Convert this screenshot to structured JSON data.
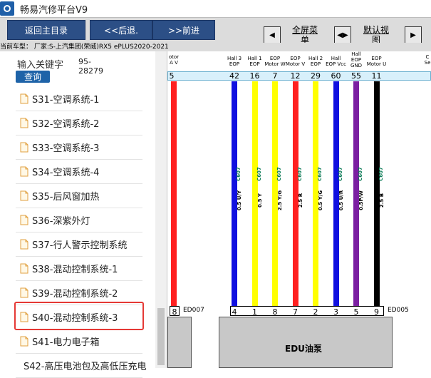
{
  "window": {
    "title": "畅易汽修平台V9"
  },
  "toolbar": {
    "home_label": "返回主目录",
    "back_label": "<<后退.",
    "forward_label": ">>前进",
    "fullscreen_label": "全屏菜单",
    "default_view_label": "默认视图"
  },
  "info": {
    "vehicle_text": "当前车型： 厂家:S-上汽集团(荣威)RX5 ePLUS2020-2021"
  },
  "search": {
    "label": "输入关键字",
    "value": "95-28279",
    "button": "查询"
  },
  "list": {
    "items": [
      {
        "label": "S31-空调系统-1"
      },
      {
        "label": "S32-空调系统-2"
      },
      {
        "label": "S33-空调系统-3"
      },
      {
        "label": "S34-空调系统-4"
      },
      {
        "label": "S35-后风窗加热"
      },
      {
        "label": "S36-深紫外灯"
      },
      {
        "label": "S37-行人警示控制系统"
      },
      {
        "label": "S38-混动控制系统-1"
      },
      {
        "label": "S39-混动控制系统-2"
      },
      {
        "label": "S40-混动控制系统-3"
      },
      {
        "label": "S41-电力电子箱"
      },
      {
        "label": "S42-高压电池包及高低压充电"
      }
    ],
    "selected_index": 9
  },
  "diagram": {
    "left_pin": "5",
    "left_head": [
      "otor",
      "A V"
    ],
    "right_head": [
      "C",
      "Se"
    ],
    "wires": [
      {
        "head": [
          "Hall 3",
          "EOP"
        ],
        "top_pin": "42",
        "code": "C607",
        "spec": "0.5 U/Y",
        "color": "#1010e0",
        "bottom_pin": "4"
      },
      {
        "head": [
          "Hall 1",
          "EOP"
        ],
        "top_pin": "16",
        "code": "C607",
        "spec": "0.5  Y",
        "color": "#ffff00",
        "bottom_pin": "1"
      },
      {
        "head": [
          "EOP",
          "Motor W"
        ],
        "top_pin": "7",
        "code": "C607",
        "spec": "2.5 Y/G",
        "color": "#ffff00",
        "bottom_pin": "8"
      },
      {
        "head": [
          "EOP",
          "Motor V"
        ],
        "top_pin": "12",
        "code": "C607",
        "spec": "2.5  R",
        "color": "#ff2020",
        "bottom_pin": "7"
      },
      {
        "head": [
          "Hall 2",
          "EOP"
        ],
        "top_pin": "29",
        "code": "C607",
        "spec": "0.5 Y/G",
        "color": "#ffff00",
        "bottom_pin": "2"
      },
      {
        "head": [
          "Hall",
          "EOP Vcc"
        ],
        "top_pin": "60",
        "code": "C607",
        "spec": "0.5 U/R",
        "color": "#1010e0",
        "bottom_pin": "3"
      },
      {
        "head": [
          "Hall",
          "EOP",
          "GND"
        ],
        "top_pin": "55",
        "code": "C607",
        "spec": "0.5P/W",
        "color": "#7b1fa2",
        "bottom_pin": "5"
      },
      {
        "head": [
          "EOP",
          "Motor U"
        ],
        "top_pin": "11",
        "code": "C607",
        "spec": "2.5  B",
        "color": "#000000",
        "bottom_pin": "9"
      }
    ],
    "left_wire_color": "#ff2020",
    "left_bottom_pin": "8",
    "connector_left": "ED007",
    "connector_right": "ED005",
    "module_label": "EDU油泵"
  }
}
